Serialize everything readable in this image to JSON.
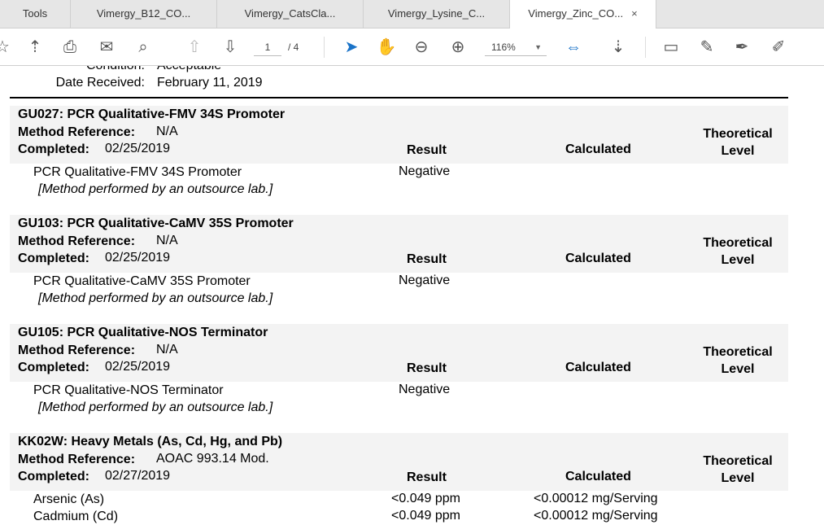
{
  "tabs": [
    {
      "label": "Tools"
    },
    {
      "label": "Vimergy_B12_CO..."
    },
    {
      "label": "Vimergy_CatsCla..."
    },
    {
      "label": "Vimergy_Lysine_C..."
    },
    {
      "label": "Vimergy_Zinc_CO...",
      "close": "×"
    }
  ],
  "toolbar": {
    "page_current": "1",
    "page_total": "/ 4",
    "zoom": "116%"
  },
  "doc": {
    "condition_label": "Condition:",
    "condition_value": "Acceptable",
    "date_label": "Date Received:",
    "date_value": "February 11, 2019",
    "sections": [
      {
        "title": "GU027: PCR Qualitative-FMV 34S Promoter",
        "method_label": "Method Reference:",
        "method": "N/A",
        "completed_label": "Completed:",
        "completed": "02/25/2019",
        "result_h": "Result",
        "calc_h": "Calculated",
        "theo_h1": "Theoretical",
        "theo_h2": "Level",
        "items": [
          {
            "name": "PCR Qualitative-FMV 34S Promoter",
            "result": "Negative"
          }
        ],
        "note": "[Method performed by an outsource lab.]"
      },
      {
        "title": "GU103: PCR Qualitative-CaMV 35S Promoter",
        "method_label": "Method Reference:",
        "method": "N/A",
        "completed_label": "Completed:",
        "completed": "02/25/2019",
        "result_h": "Result",
        "calc_h": "Calculated",
        "theo_h1": "Theoretical",
        "theo_h2": "Level",
        "items": [
          {
            "name": "PCR Qualitative-CaMV 35S Promoter",
            "result": "Negative"
          }
        ],
        "note": "[Method performed by an outsource lab.]"
      },
      {
        "title": "GU105: PCR Qualitative-NOS Terminator",
        "method_label": "Method Reference:",
        "method": "N/A",
        "completed_label": "Completed:",
        "completed": "02/25/2019",
        "result_h": "Result",
        "calc_h": "Calculated",
        "theo_h1": "Theoretical",
        "theo_h2": "Level",
        "items": [
          {
            "name": "PCR Qualitative-NOS Terminator",
            "result": "Negative"
          }
        ],
        "note": "[Method performed by an outsource lab.]"
      },
      {
        "title": "KK02W: Heavy Metals (As, Cd, Hg, and Pb)",
        "method_label": "Method Reference:",
        "method": "AOAC 993.14 Mod.",
        "completed_label": "Completed:",
        "completed": "02/27/2019",
        "result_h": "Result",
        "calc_h": "Calculated",
        "theo_h1": "Theoretical",
        "theo_h2": "Level",
        "items": [
          {
            "name": "Arsenic (As)",
            "result": "<0.049 ppm",
            "calc": "<0.00012 mg/Serving"
          },
          {
            "name": "Cadmium (Cd)",
            "result": "<0.049 ppm",
            "calc": "<0.00012 mg/Serving"
          }
        ]
      }
    ]
  }
}
